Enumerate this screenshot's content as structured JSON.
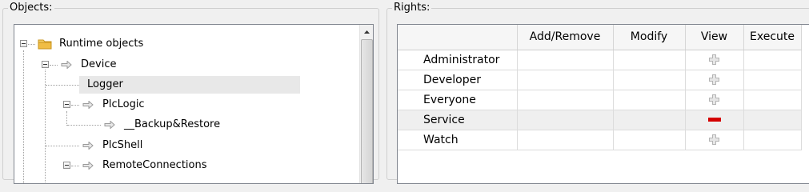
{
  "objects_panel": {
    "title": "Objects:",
    "tree": [
      {
        "label": "Runtime objects",
        "icon": "folder-icon",
        "expander": "minus"
      },
      {
        "label": "Device",
        "icon": "arrow-icon",
        "expander": "minus"
      },
      {
        "label": "Logger",
        "icon": "arrow-icon",
        "expander": "none",
        "selected": true
      },
      {
        "label": "PlcLogic",
        "icon": "arrow-icon",
        "expander": "minus"
      },
      {
        "label": "__Backup&Restore",
        "icon": "arrow-icon",
        "expander": "none"
      },
      {
        "label": "PlcShell",
        "icon": "arrow-icon",
        "expander": "none"
      },
      {
        "label": "RemoteConnections",
        "icon": "arrow-icon",
        "expander": "minus"
      }
    ]
  },
  "rights_panel": {
    "title": "Rights:",
    "columns": [
      "",
      "Add/Remove",
      "Modify",
      "View",
      "Execute"
    ],
    "rows": [
      {
        "role": "Administrator",
        "view": "grant-default"
      },
      {
        "role": "Developer",
        "view": "grant-default"
      },
      {
        "role": "Everyone",
        "view": "grant-default"
      },
      {
        "role": "Service",
        "view": "deny",
        "highlight": true
      },
      {
        "role": "Watch",
        "view": "grant-default"
      }
    ]
  },
  "colors": {
    "deny": "#d40000",
    "grant_default": "#b4b4b4",
    "folder": "#e9b84a",
    "arrow": "#a8a8a8"
  }
}
